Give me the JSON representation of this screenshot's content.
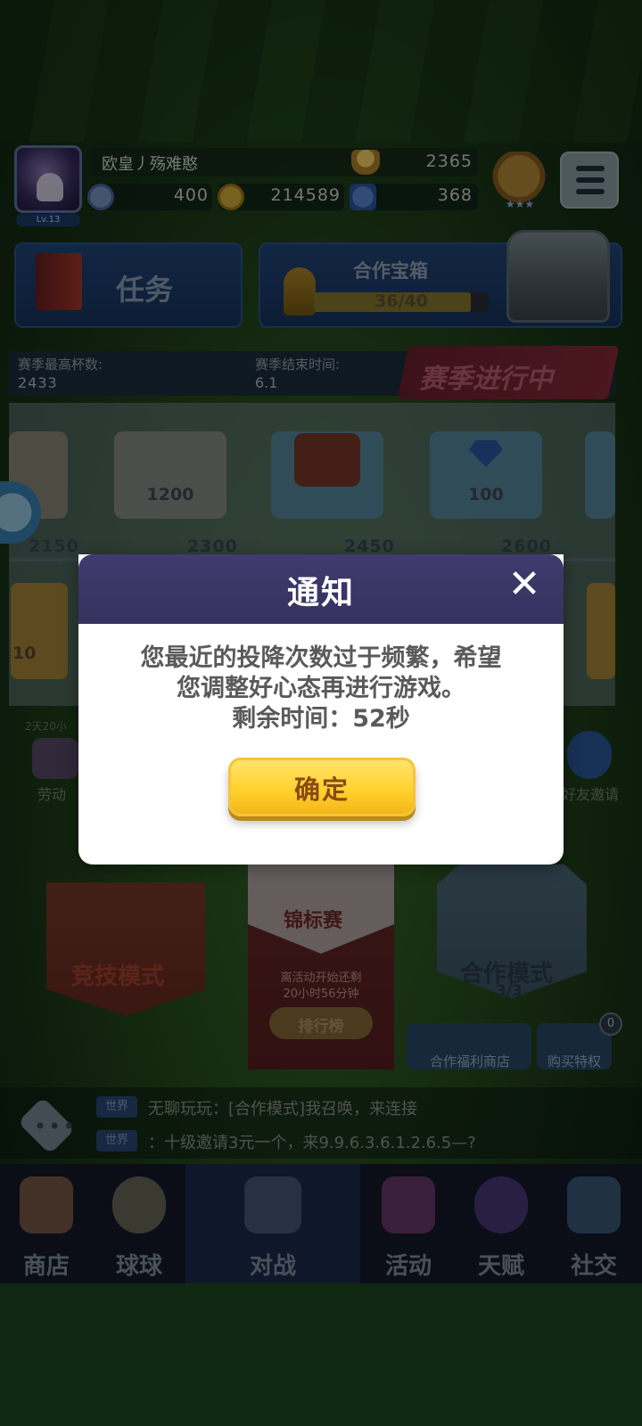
{
  "header": {
    "player_name": "欧皇丿殇难憨",
    "level": "Lv.13",
    "trophies": "2365",
    "resource1": "400",
    "gold": "214589",
    "gems": "368"
  },
  "task": {
    "label": "任务"
  },
  "coop_chest": {
    "title": "合作宝箱",
    "progress_text": "36/40",
    "progress": 0.9
  },
  "season": {
    "best_label": "赛季最高杯数:",
    "best_value": "2433",
    "end_label": "赛季结束时间:",
    "end_value": "6.1",
    "status": "赛季进行中"
  },
  "rewards": {
    "row1": [
      {
        "value": "1200"
      },
      {
        "value": ""
      },
      {
        "value": "100"
      }
    ],
    "milestones": [
      "2150",
      "2300",
      "2450",
      "2600"
    ],
    "row2_left_value": "10"
  },
  "side": {
    "timer_left": "2天20小",
    "labor_label": "劳动",
    "friend_invite": "好友邀请"
  },
  "modes": {
    "competitive": "竞技模式",
    "tournament": "锦标赛",
    "tournament_sub1": "离活动开始还剩",
    "tournament_sub2": "20小时56分钟",
    "rank_button": "排行榜",
    "coop": "合作模式",
    "coop_count": "3/3",
    "coop_shop": "合作福利商店",
    "buy_privilege": "购买特权",
    "badge_count": "0"
  },
  "chat": {
    "tag": "世界",
    "line1": "无聊玩玩：[合作模式]我召唤，来连接",
    "line2": "：十级邀请3元一个，来9.9.6.3.6.1.2.6.5—?"
  },
  "nav": [
    {
      "label": "商店",
      "name": "nav-shop"
    },
    {
      "label": "球球",
      "name": "nav-balls"
    },
    {
      "label": "对战",
      "name": "nav-battle"
    },
    {
      "label": "活动",
      "name": "nav-events"
    },
    {
      "label": "天赋",
      "name": "nav-talent"
    },
    {
      "label": "社交",
      "name": "nav-social"
    }
  ],
  "modal": {
    "title": "通知",
    "line1": "您最近的投降次数过于频繁，希望",
    "line2": "您调整好心态再进行游戏。",
    "line3": "剩余时间：52秒",
    "confirm": "确定"
  },
  "colors": {
    "modal_header": "#3f3b6e",
    "confirm_button": "#ffd02a",
    "confirm_text": "#8a4a12"
  }
}
